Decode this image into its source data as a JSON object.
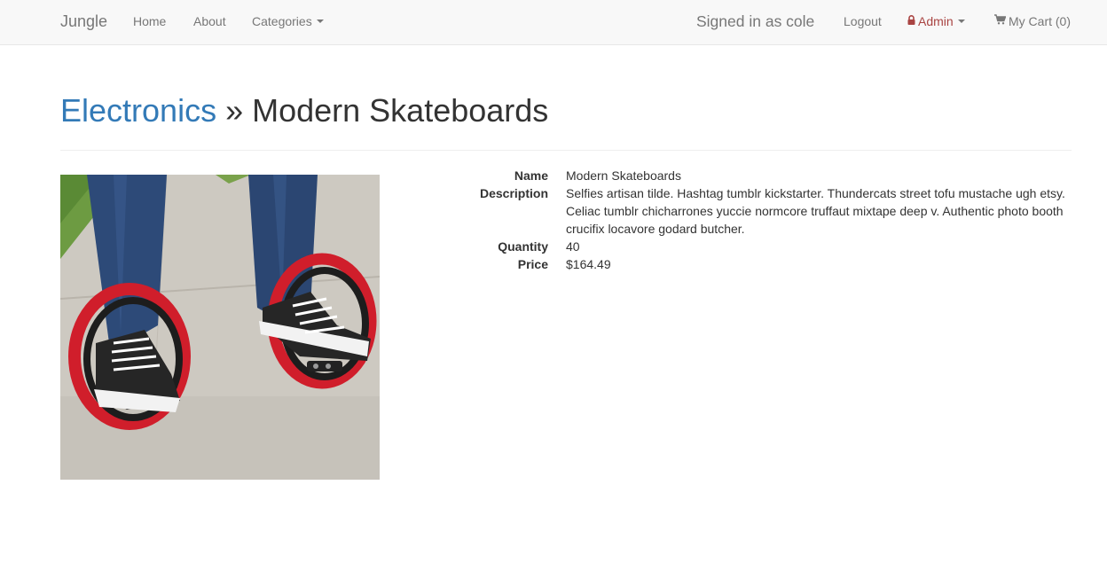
{
  "navbar": {
    "brand": "Jungle",
    "home": "Home",
    "about": "About",
    "categories": "Categories",
    "signed_in": "Signed in as cole",
    "logout": "Logout",
    "admin": "Admin",
    "cart": "My Cart (0)"
  },
  "page": {
    "category": "Electronics",
    "separator": " » ",
    "title": "Modern Skateboards"
  },
  "product": {
    "labels": {
      "name": "Name",
      "description": "Description",
      "quantity": "Quantity",
      "price": "Price"
    },
    "name": "Modern Skateboards",
    "description": "Selfies artisan tilde. Hashtag tumblr kickstarter. Thundercats street tofu mustache ugh etsy. Celiac tumblr chicharrones yuccie normcore truffaut mixtape deep v. Authentic photo booth crucifix locavore godard butcher.",
    "quantity": "40",
    "price": "$164.49"
  },
  "colors": {
    "link": "#337ab7",
    "admin": "#a94442",
    "navbar_bg": "#f8f8f8",
    "nav_text": "#777777"
  },
  "icons": [
    "lock-icon",
    "cart-icon",
    "caret-down-icon"
  ]
}
